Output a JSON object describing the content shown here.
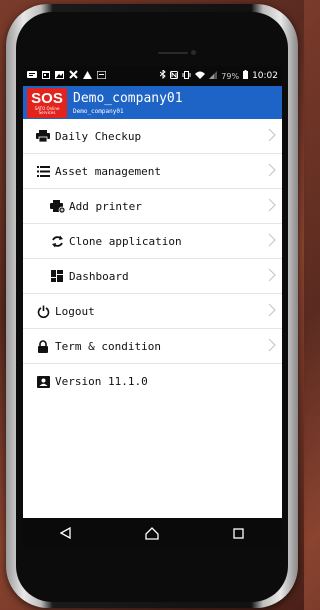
{
  "statusbar": {
    "battery_percent": "79%",
    "time": "10:02",
    "left_icons": [
      "message-icon",
      "calendar-icon",
      "image-icon",
      "tools-icon",
      "warning-icon",
      "app-icon"
    ],
    "right_icons": [
      "bluetooth-icon",
      "nfc-icon",
      "vibrate-icon",
      "wifi-icon",
      "signal-icon",
      "battery-icon"
    ]
  },
  "header": {
    "logo_text": "SOS",
    "logo_subtext": "SATO Online Services",
    "title": "Demo_company01",
    "subtitle": "Demo_company01",
    "color": "#1e63c6",
    "logo_color": "#e2241c"
  },
  "menu": {
    "items": [
      {
        "label": "Daily Checkup",
        "icon": "printer-icon",
        "sub": false
      },
      {
        "label": "Asset management",
        "icon": "list-icon",
        "sub": false
      },
      {
        "label": "Add printer",
        "icon": "add-printer-icon",
        "sub": true
      },
      {
        "label": "Clone application",
        "icon": "sync-icon",
        "sub": true
      },
      {
        "label": "Dashboard",
        "icon": "dashboard-icon",
        "sub": true
      },
      {
        "label": "Logout",
        "icon": "power-icon",
        "sub": false
      },
      {
        "label": "Term & condition",
        "icon": "lock-icon",
        "sub": false
      }
    ],
    "version": "Version 11.1.0"
  },
  "navbar": {
    "buttons": [
      "back-icon",
      "home-icon",
      "recents-icon"
    ]
  }
}
